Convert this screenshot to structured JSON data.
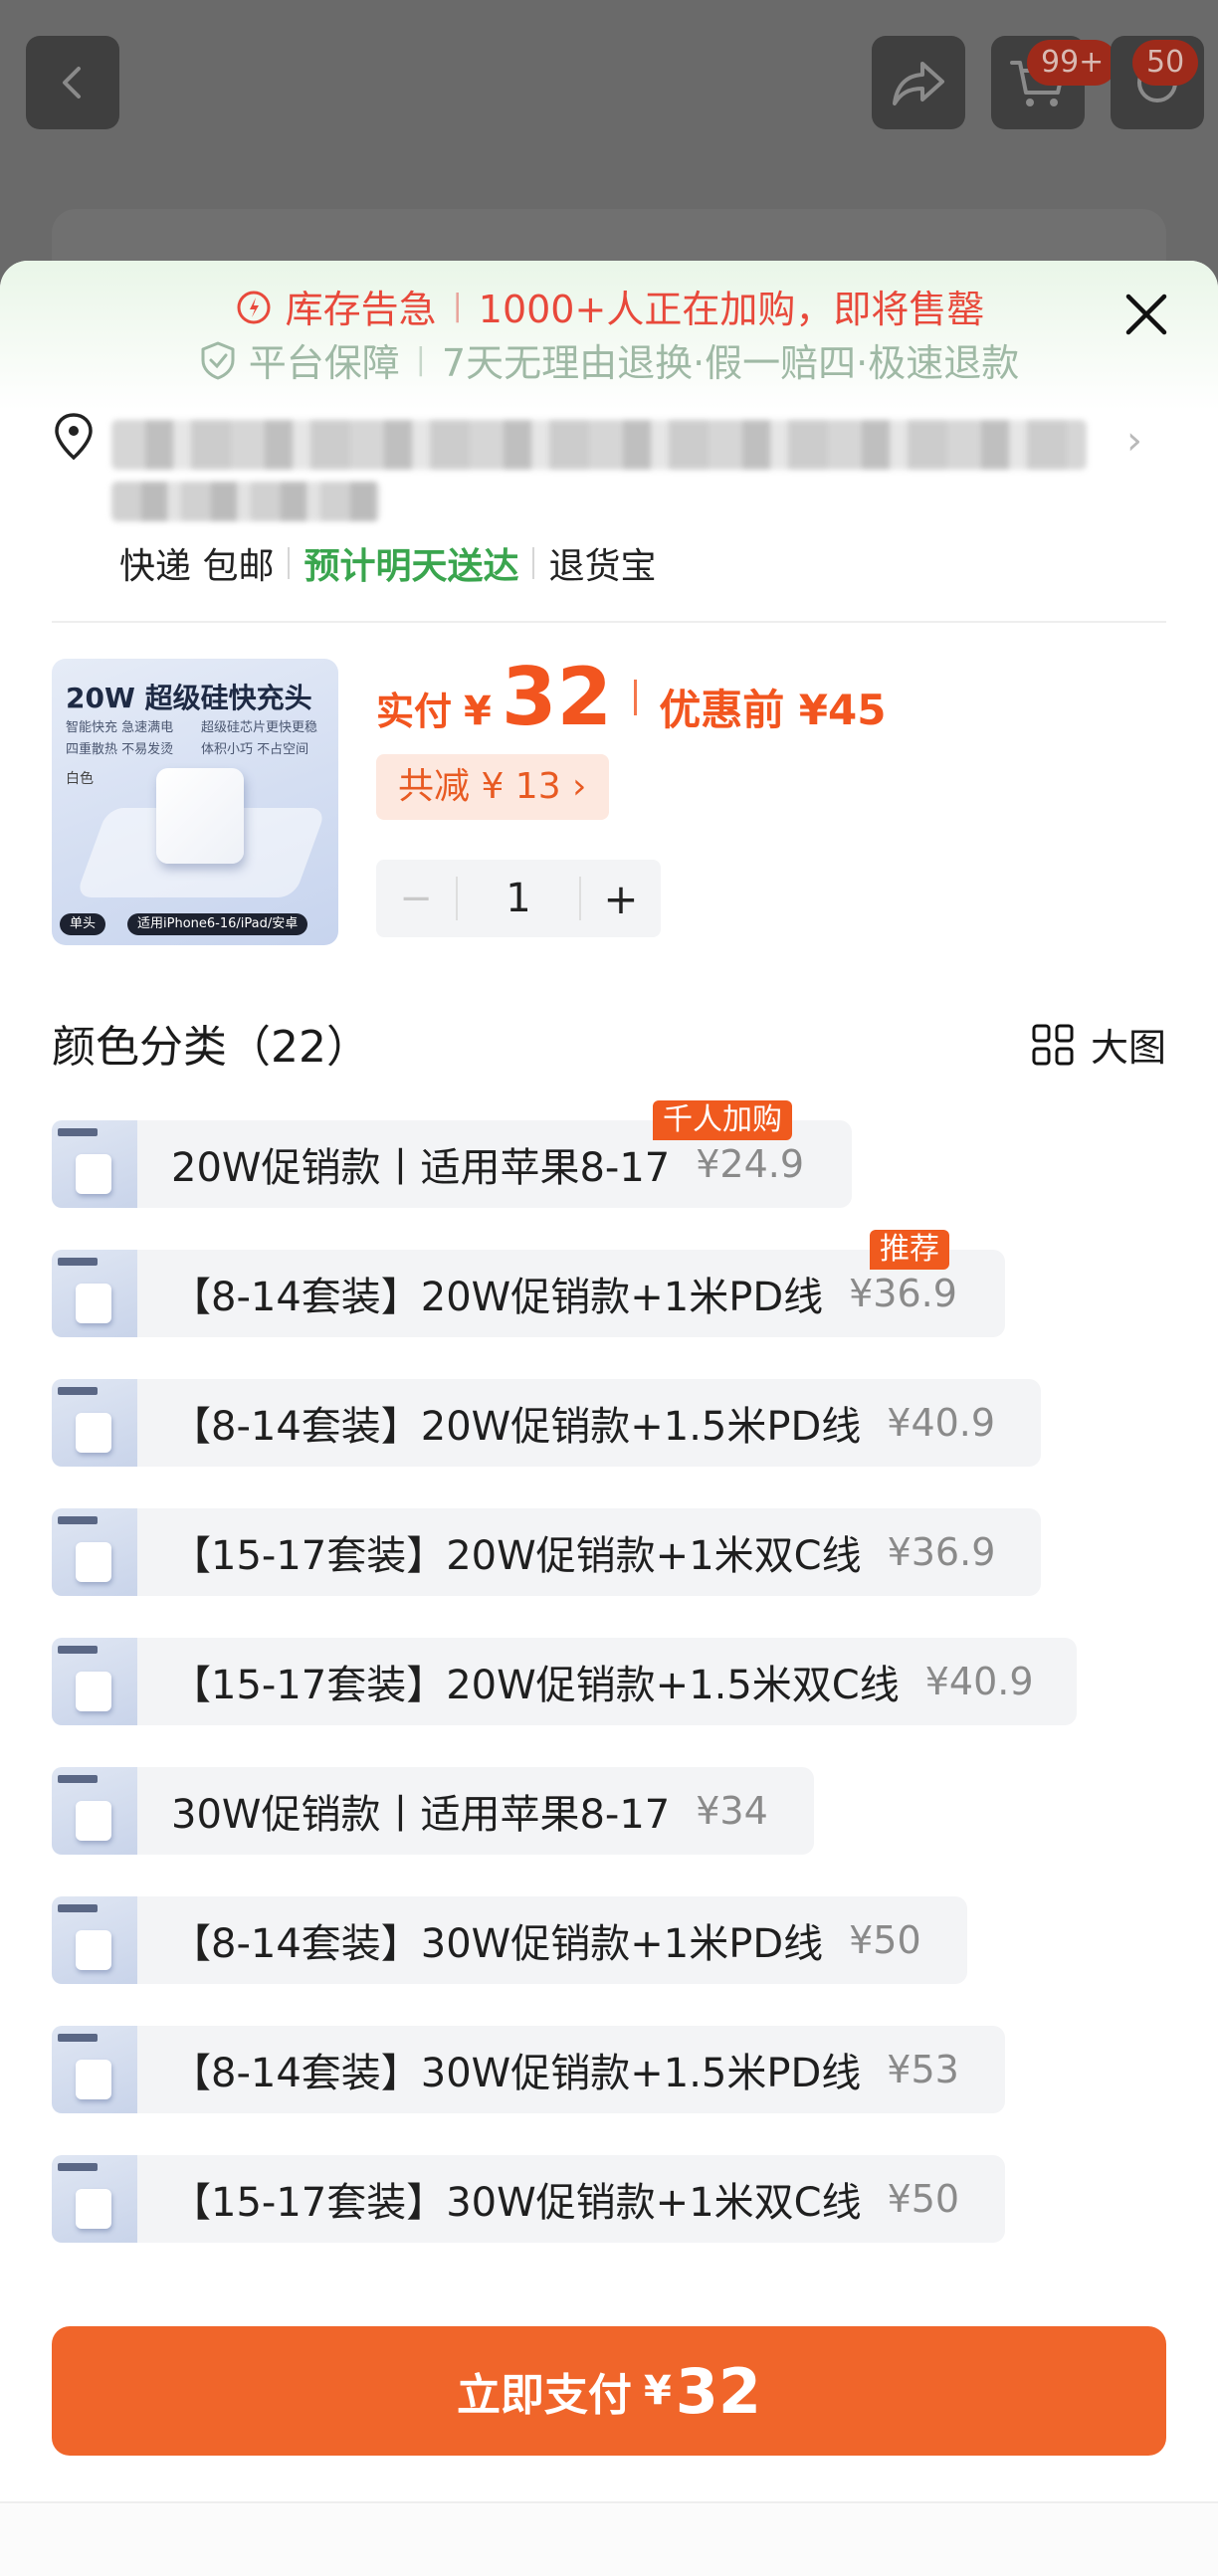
{
  "background": {
    "cart_badge": "99+",
    "message_badge": "50"
  },
  "notice": {
    "stock_alert": "库存告急",
    "stock_detail": "1000+人正在加购，即将售罄",
    "guarantee": "平台保障",
    "guarantee_detail": "7天无理由退换·假一赔四·极速退款"
  },
  "delivery": {
    "method": "快递 包邮",
    "eta": "预计明天送达",
    "insurance": "退货宝"
  },
  "product": {
    "image_title": "20W 超级硅快充头",
    "image_feature_1": "智能快充  急速满电",
    "image_feature_2": "超级硅芯片更快更稳",
    "image_feature_3": "四重散热  不易发烫",
    "image_feature_4": "体积小巧  不占空间",
    "image_color": "白色",
    "image_tag_1": "单头",
    "image_tag_2": "适用iPhone6-16/iPad/安卓"
  },
  "price": {
    "pay_label": "实付",
    "currency": "¥",
    "pay_amount": "32",
    "original_label": "优惠前 ¥45",
    "discount": "共减 ¥ 13 ›"
  },
  "quantity": {
    "minus": "−",
    "value": "1",
    "plus": "+"
  },
  "variants_section": {
    "title": "颜色分类（22）",
    "big_image": "大图"
  },
  "variants": [
    {
      "name": "20W促销款丨适用苹果8-17",
      "price": "¥24.9",
      "tag": "千人加购"
    },
    {
      "name": "【8-14套装】20W促销款+1米PD线",
      "price": "¥36.9",
      "tag": "推荐"
    },
    {
      "name": "【8-14套装】20W促销款+1.5米PD线",
      "price": "¥40.9",
      "tag": ""
    },
    {
      "name": "【15-17套装】20W促销款+1米双C线",
      "price": "¥36.9",
      "tag": ""
    },
    {
      "name": "【15-17套装】20W促销款+1.5米双C线",
      "price": "¥40.9",
      "tag": ""
    },
    {
      "name": "30W促销款丨适用苹果8-17",
      "price": "¥34",
      "tag": ""
    },
    {
      "name": "【8-14套装】30W促销款+1米PD线",
      "price": "¥50",
      "tag": ""
    },
    {
      "name": "【8-14套装】30W促销款+1.5米PD线",
      "price": "¥53",
      "tag": ""
    },
    {
      "name": "【15-17套装】30W促销款+1米双C线",
      "price": "¥50",
      "tag": ""
    }
  ],
  "pay_button": {
    "label": "立即支付",
    "currency": "¥",
    "amount": "32"
  },
  "colors": {
    "accent": "#f0652a",
    "price": "#f2551f",
    "alert": "#e8493b",
    "eta_green": "#3aa54e"
  }
}
